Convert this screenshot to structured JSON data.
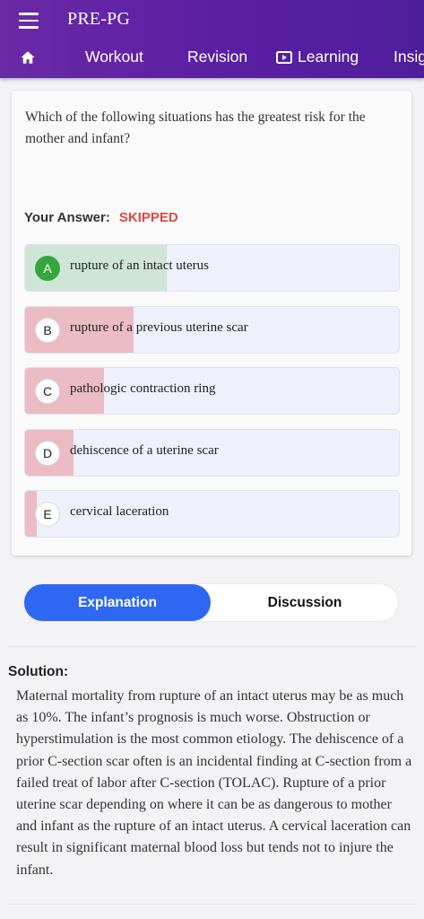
{
  "app": {
    "title": "PRE-PG"
  },
  "nav": {
    "items": [
      {
        "label": "Workout"
      },
      {
        "label": "Revision"
      },
      {
        "label": "Learning"
      },
      {
        "label": "Insig"
      }
    ]
  },
  "question": {
    "text": "Which of the following situations has the greatest risk for the mother and infant?",
    "your_answer_label": "Your Answer:",
    "your_answer_value": "SKIPPED",
    "options": [
      {
        "letter": "A",
        "text": "rupture of an intact uterus",
        "response_share": 0.38,
        "correct": true
      },
      {
        "letter": "B",
        "text": "rupture of a previous uterine scar",
        "response_share": 0.29,
        "correct": false
      },
      {
        "letter": "C",
        "text": "pathologic contraction ring",
        "response_share": 0.21,
        "correct": false
      },
      {
        "letter": "D",
        "text": "dehiscence of a uterine scar",
        "response_share": 0.13,
        "correct": false
      },
      {
        "letter": "E",
        "text": "cervical laceration",
        "response_share": 0.03,
        "correct": false
      }
    ]
  },
  "tabs": {
    "explanation": "Explanation",
    "discussion": "Discussion"
  },
  "solution": {
    "label": "Solution:",
    "text": "Maternal mortality from rupture of an intact uterus may be as much as 10%. The infant’s prognosis is much worse. Obstruction or hyperstimulation is the most common etiology. The dehiscence of a prior C-section scar often is an incidental finding at C-section from a failed treat of labor after C-section (TOLAC). Rupture of a prior uterine scar depending on where it can be as dangerous to mother and infant as the rupture of an intact uterus. A cervical laceration can result in significant maternal blood loss but tends not to injure the infant."
  },
  "colors": {
    "correct_fill": "#cfe6d6",
    "incorrect_fill": "#ecbcc5",
    "accent": "#2e67f2",
    "skipped": "#e04646"
  }
}
